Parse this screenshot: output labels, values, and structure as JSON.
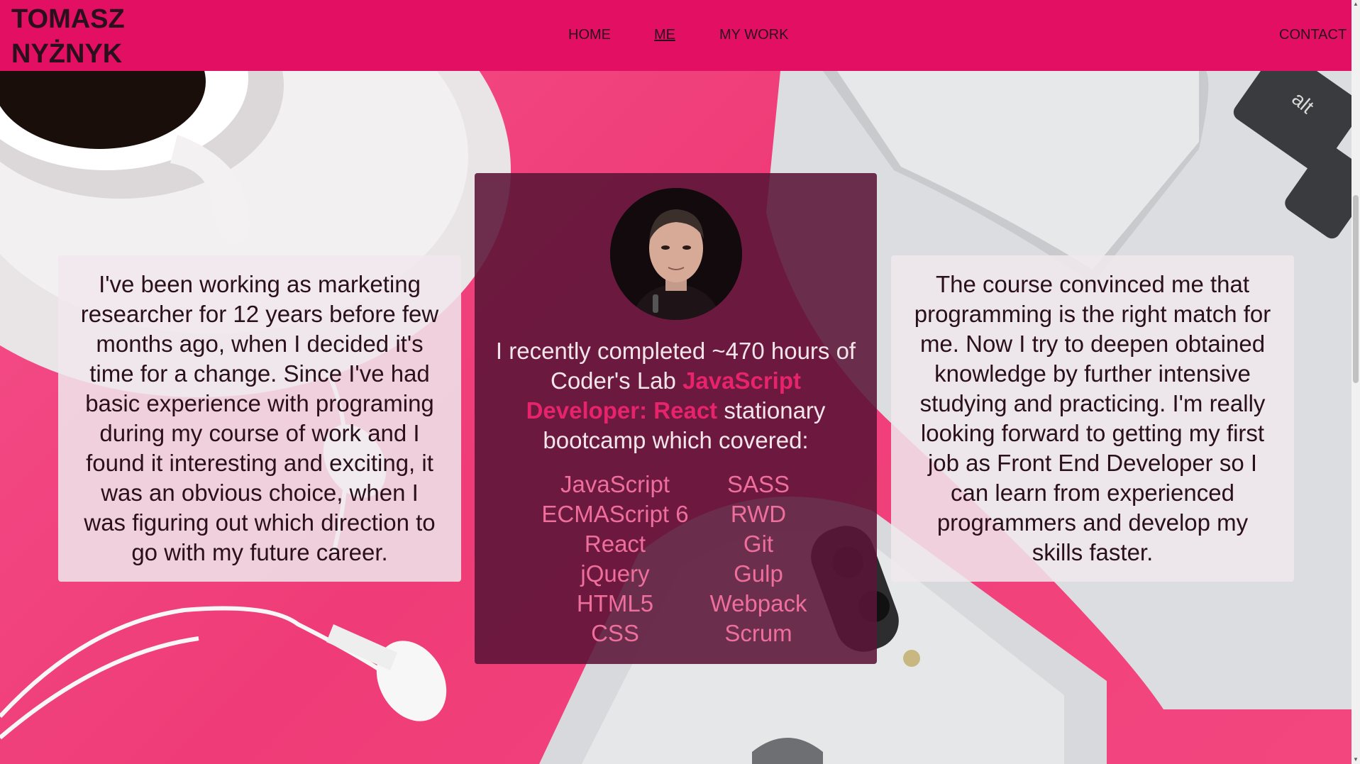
{
  "header": {
    "logo_line1": "TOMASZ",
    "logo_line2": "NYŻNYK",
    "nav": {
      "home": "HOME",
      "me": "ME",
      "my_work": "MY WORK",
      "contact": "CONTACT"
    },
    "active_item": "ME"
  },
  "left_card": {
    "text": "I've been working as marketing researcher for 12 years before few months ago, when I decided it's time for a change. Since I've had basic experience with programing during my course of work and I found it interesting and exciting, it was an obvious choice, when I was figuring out which direction to go with my future career."
  },
  "center_card": {
    "intro_before": "I recently completed ~470 hours of Coder's Lab ",
    "intro_highlight": "JavaScript Developer: React",
    "intro_after": " stationary bootcamp which covered:",
    "skills_left": [
      "JavaScript",
      "ECMAScript 6",
      "React",
      "jQuery",
      "HTML5",
      "CSS"
    ],
    "skills_right": [
      "SASS",
      "RWD",
      "Git",
      "Gulp",
      "Webpack",
      "Scrum"
    ]
  },
  "right_card": {
    "text": "The course convinced me that programming is the right match for me. Now I try to deepen obtained knowledge by further intensive studying and practicing. I'm really looking forward to getting my first job as Front End Developer so I can learn from experienced programmers and develop my skills faster."
  },
  "icons": {
    "scroll_up": "scroll-up-arrow-icon",
    "scroll_down": "scroll-down-arrow-icon"
  },
  "colors": {
    "header_bg": "#e20f63",
    "accent": "#e6236b",
    "skill_text": "#ee6e9c",
    "dark_card_bg": "#5a1437",
    "dark_text": "#2a0f1c"
  }
}
